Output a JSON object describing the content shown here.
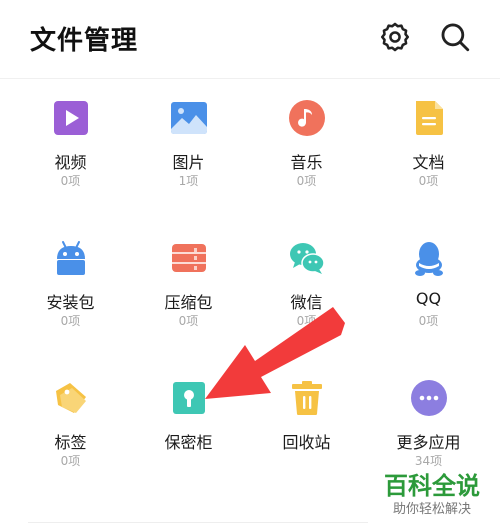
{
  "header": {
    "title": "文件管理",
    "settings_icon": "gear-icon",
    "search_icon": "search-icon"
  },
  "categories": [
    {
      "label": "视频",
      "count": "0项",
      "icon": "video-icon",
      "color": "#9b5fd6"
    },
    {
      "label": "图片",
      "count": "1项",
      "icon": "image-icon",
      "color": "#4a90e8"
    },
    {
      "label": "音乐",
      "count": "0项",
      "icon": "music-icon",
      "color": "#f0725c"
    },
    {
      "label": "文档",
      "count": "0项",
      "icon": "document-icon",
      "color": "#f6c244"
    },
    {
      "label": "安装包",
      "count": "0项",
      "icon": "android-icon",
      "color": "#4a90e8"
    },
    {
      "label": "压缩包",
      "count": "0项",
      "icon": "archive-icon",
      "color": "#f0725c"
    },
    {
      "label": "微信",
      "count": "0项",
      "icon": "wechat-icon",
      "color": "#3ec7b4"
    },
    {
      "label": "QQ",
      "count": "0项",
      "icon": "qq-icon",
      "color": "#4a90e8"
    },
    {
      "label": "标签",
      "count": "0项",
      "icon": "tag-icon",
      "color": "#f6c244"
    },
    {
      "label": "保密柜",
      "count": "",
      "icon": "safe-icon",
      "color": "#3ec7b4"
    },
    {
      "label": "回收站",
      "count": "",
      "icon": "trash-icon",
      "color": "#f6c244"
    },
    {
      "label": "更多应用",
      "count": "34项",
      "icon": "more-icon",
      "color": "#8c7ee0"
    }
  ],
  "watermark": {
    "main": "百科全说",
    "sub": "助你轻松解决"
  }
}
